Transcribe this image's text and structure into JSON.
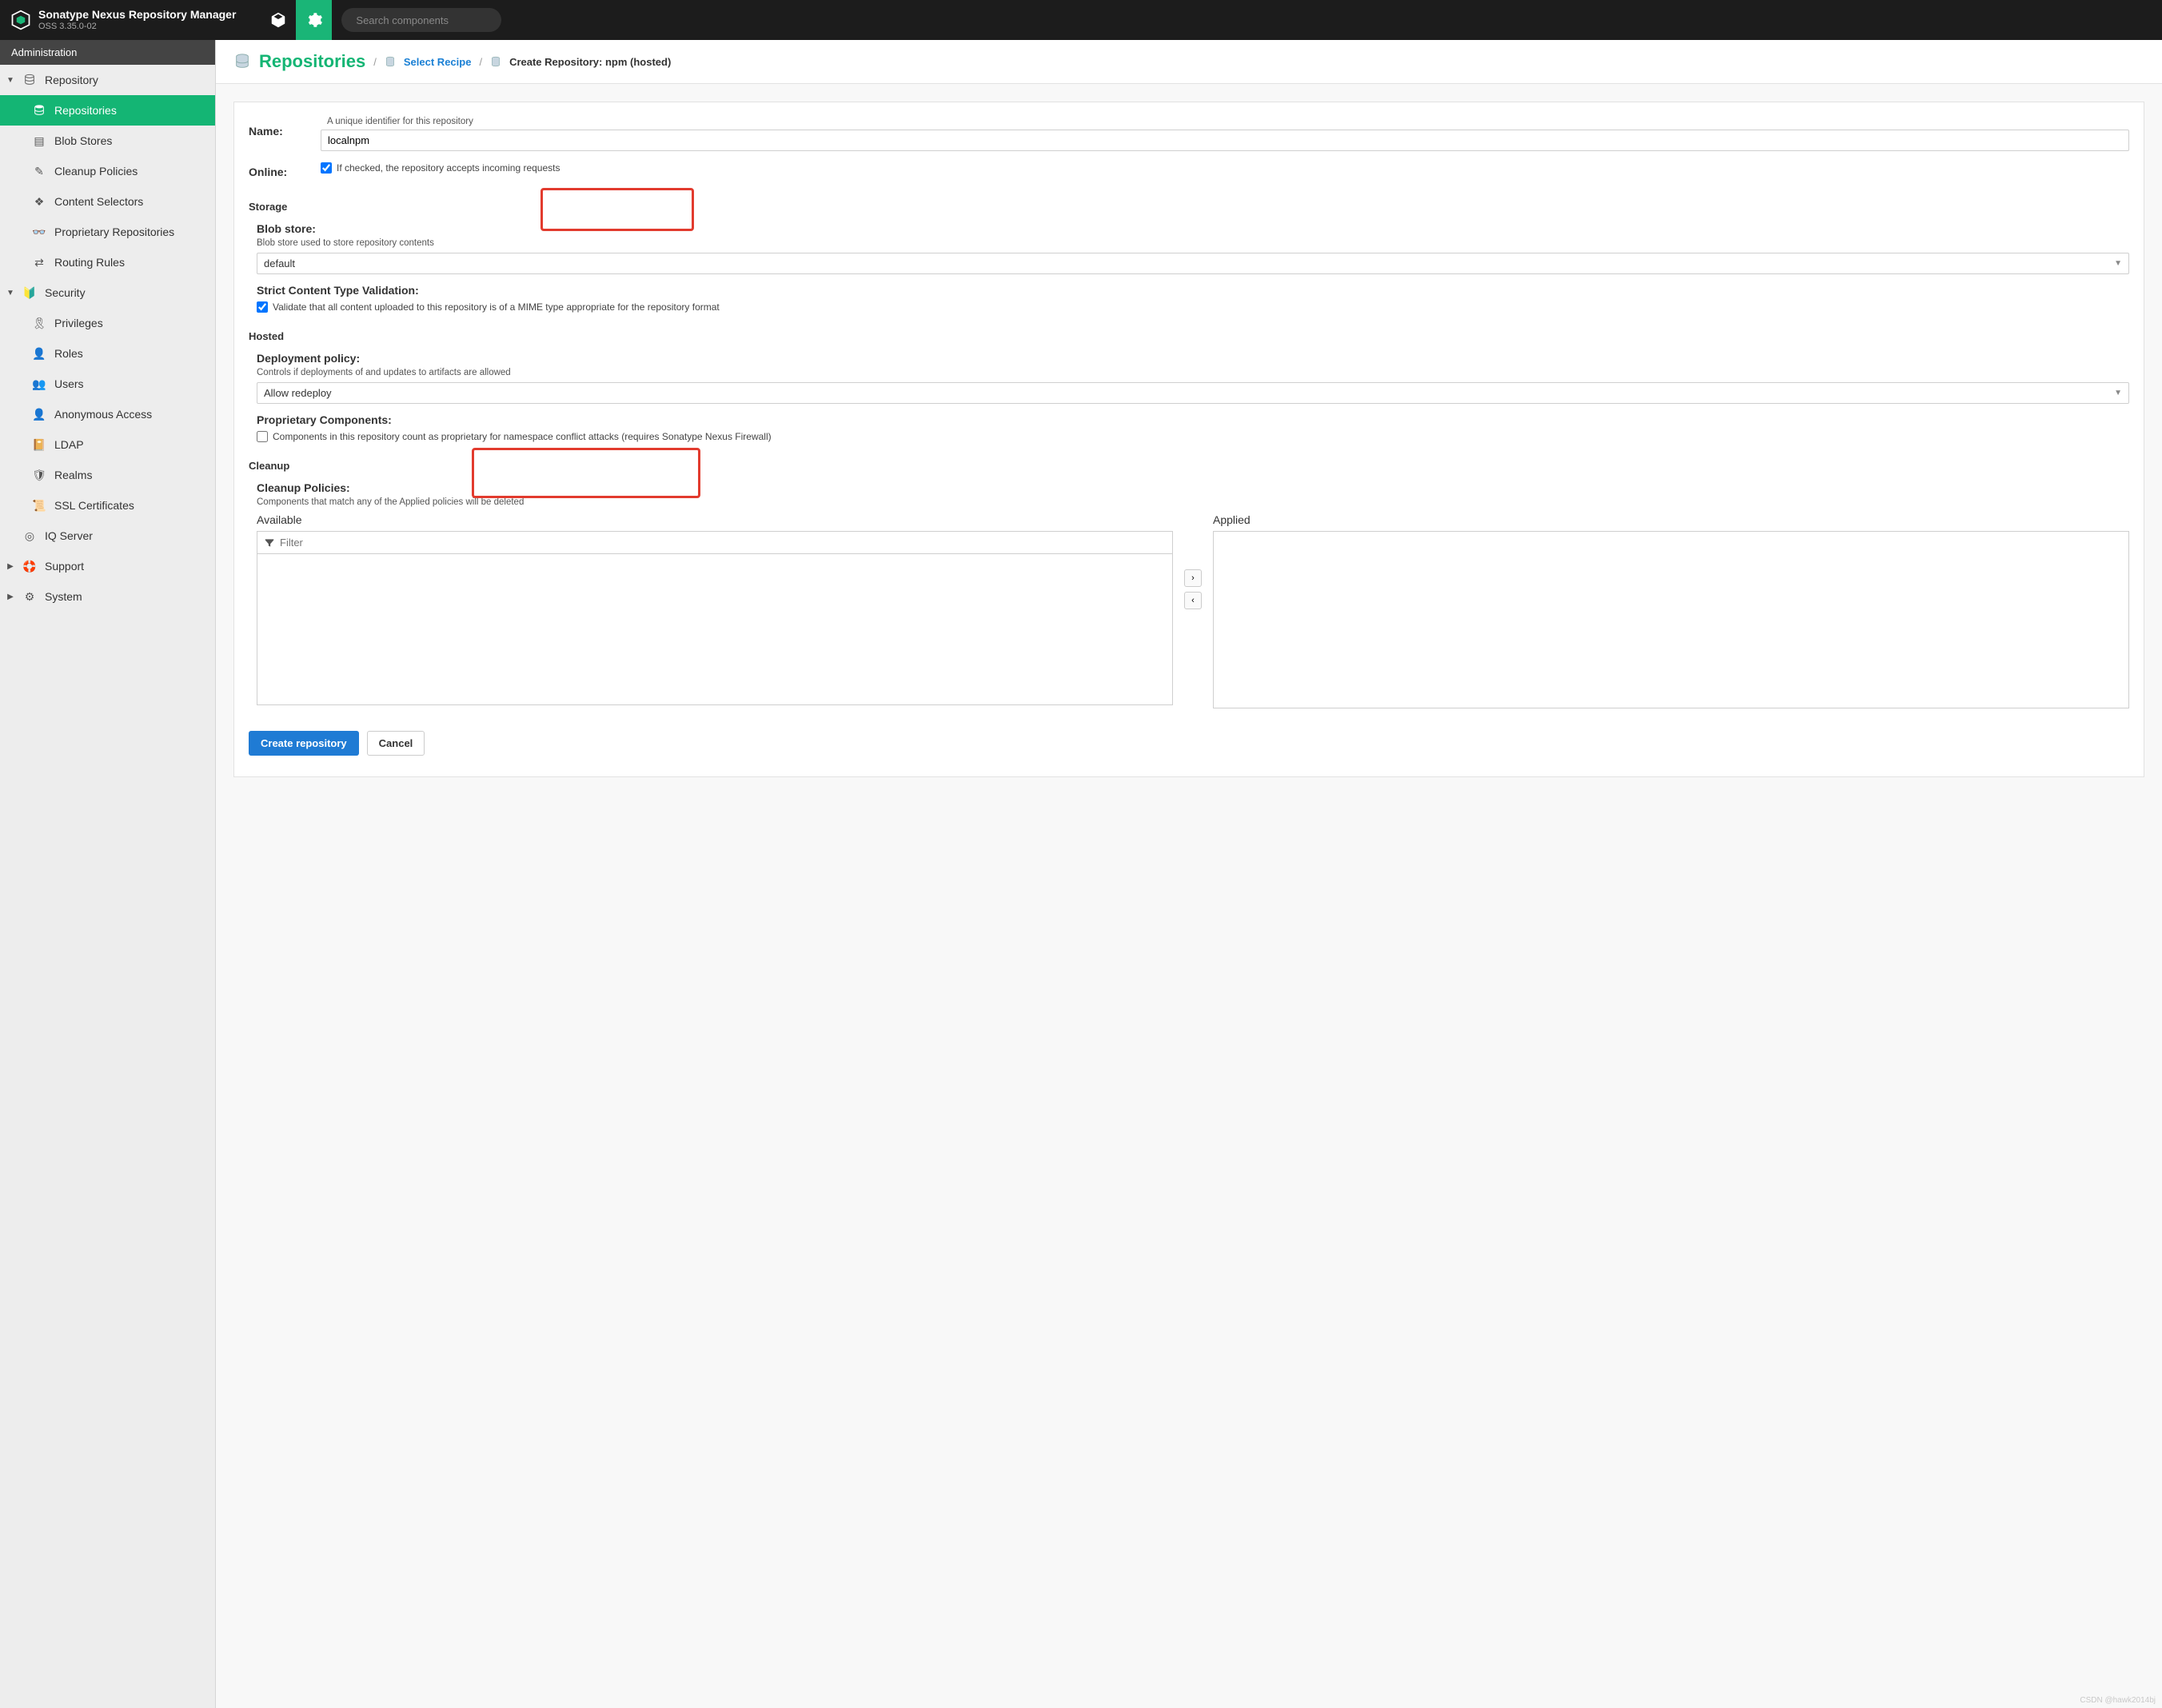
{
  "header": {
    "title": "Sonatype Nexus Repository Manager",
    "subtitle": "OSS 3.35.0-02",
    "search_placeholder": "Search components"
  },
  "sidebar": {
    "heading": "Administration",
    "groups": [
      {
        "label": "Repository",
        "expanded": true,
        "children": [
          {
            "label": "Repositories",
            "active": true,
            "icon": "db"
          },
          {
            "label": "Blob Stores",
            "icon": "bars"
          },
          {
            "label": "Cleanup Policies",
            "icon": "broom"
          },
          {
            "label": "Content Selectors",
            "icon": "layers"
          },
          {
            "label": "Proprietary Repositories",
            "icon": "binoc"
          },
          {
            "label": "Routing Rules",
            "icon": "routes"
          }
        ]
      },
      {
        "label": "Security",
        "expanded": true,
        "children": [
          {
            "label": "Privileges",
            "icon": "ribbon"
          },
          {
            "label": "Roles",
            "icon": "person-tie"
          },
          {
            "label": "Users",
            "icon": "people"
          },
          {
            "label": "Anonymous Access",
            "icon": "user"
          },
          {
            "label": "LDAP",
            "icon": "book"
          },
          {
            "label": "Realms",
            "icon": "shield"
          },
          {
            "label": "SSL Certificates",
            "icon": "cert"
          }
        ]
      },
      {
        "label": "IQ Server",
        "expanded": false,
        "leaf": true,
        "icon": "iq"
      },
      {
        "label": "Support",
        "expanded": false,
        "icon": "lifebuoy"
      },
      {
        "label": "System",
        "expanded": false,
        "icon": "gear"
      }
    ]
  },
  "breadcrumb": {
    "title": "Repositories",
    "recipe": "Select Recipe",
    "current": "Create Repository: npm (hosted)"
  },
  "form": {
    "name": {
      "label": "Name:",
      "hint": "A unique identifier for this repository",
      "value": "localnpm"
    },
    "online": {
      "label": "Online:",
      "hint": "If checked, the repository accepts incoming requests",
      "checked": true
    },
    "storage_title": "Storage",
    "blob": {
      "label": "Blob store:",
      "hint": "Blob store used to store repository contents",
      "value": "default"
    },
    "strict": {
      "label": "Strict Content Type Validation:",
      "hint": "Validate that all content uploaded to this repository is of a MIME type appropriate for the repository format",
      "checked": true
    },
    "hosted_title": "Hosted",
    "deploy": {
      "label": "Deployment policy:",
      "hint": "Controls if deployments of and updates to artifacts are allowed",
      "value": "Allow redeploy"
    },
    "proprietary": {
      "label": "Proprietary Components:",
      "hint": "Components in this repository count as proprietary for namespace conflict attacks (requires Sonatype Nexus Firewall)",
      "checked": false
    },
    "cleanup_title": "Cleanup",
    "cleanup": {
      "label": "Cleanup Policies:",
      "hint": "Components that match any of the Applied policies will be deleted",
      "available_title": "Available",
      "applied_title": "Applied",
      "filter_placeholder": "Filter"
    },
    "create_btn": "Create repository",
    "cancel_btn": "Cancel"
  },
  "watermark": "CSDN @hawk2014bj"
}
